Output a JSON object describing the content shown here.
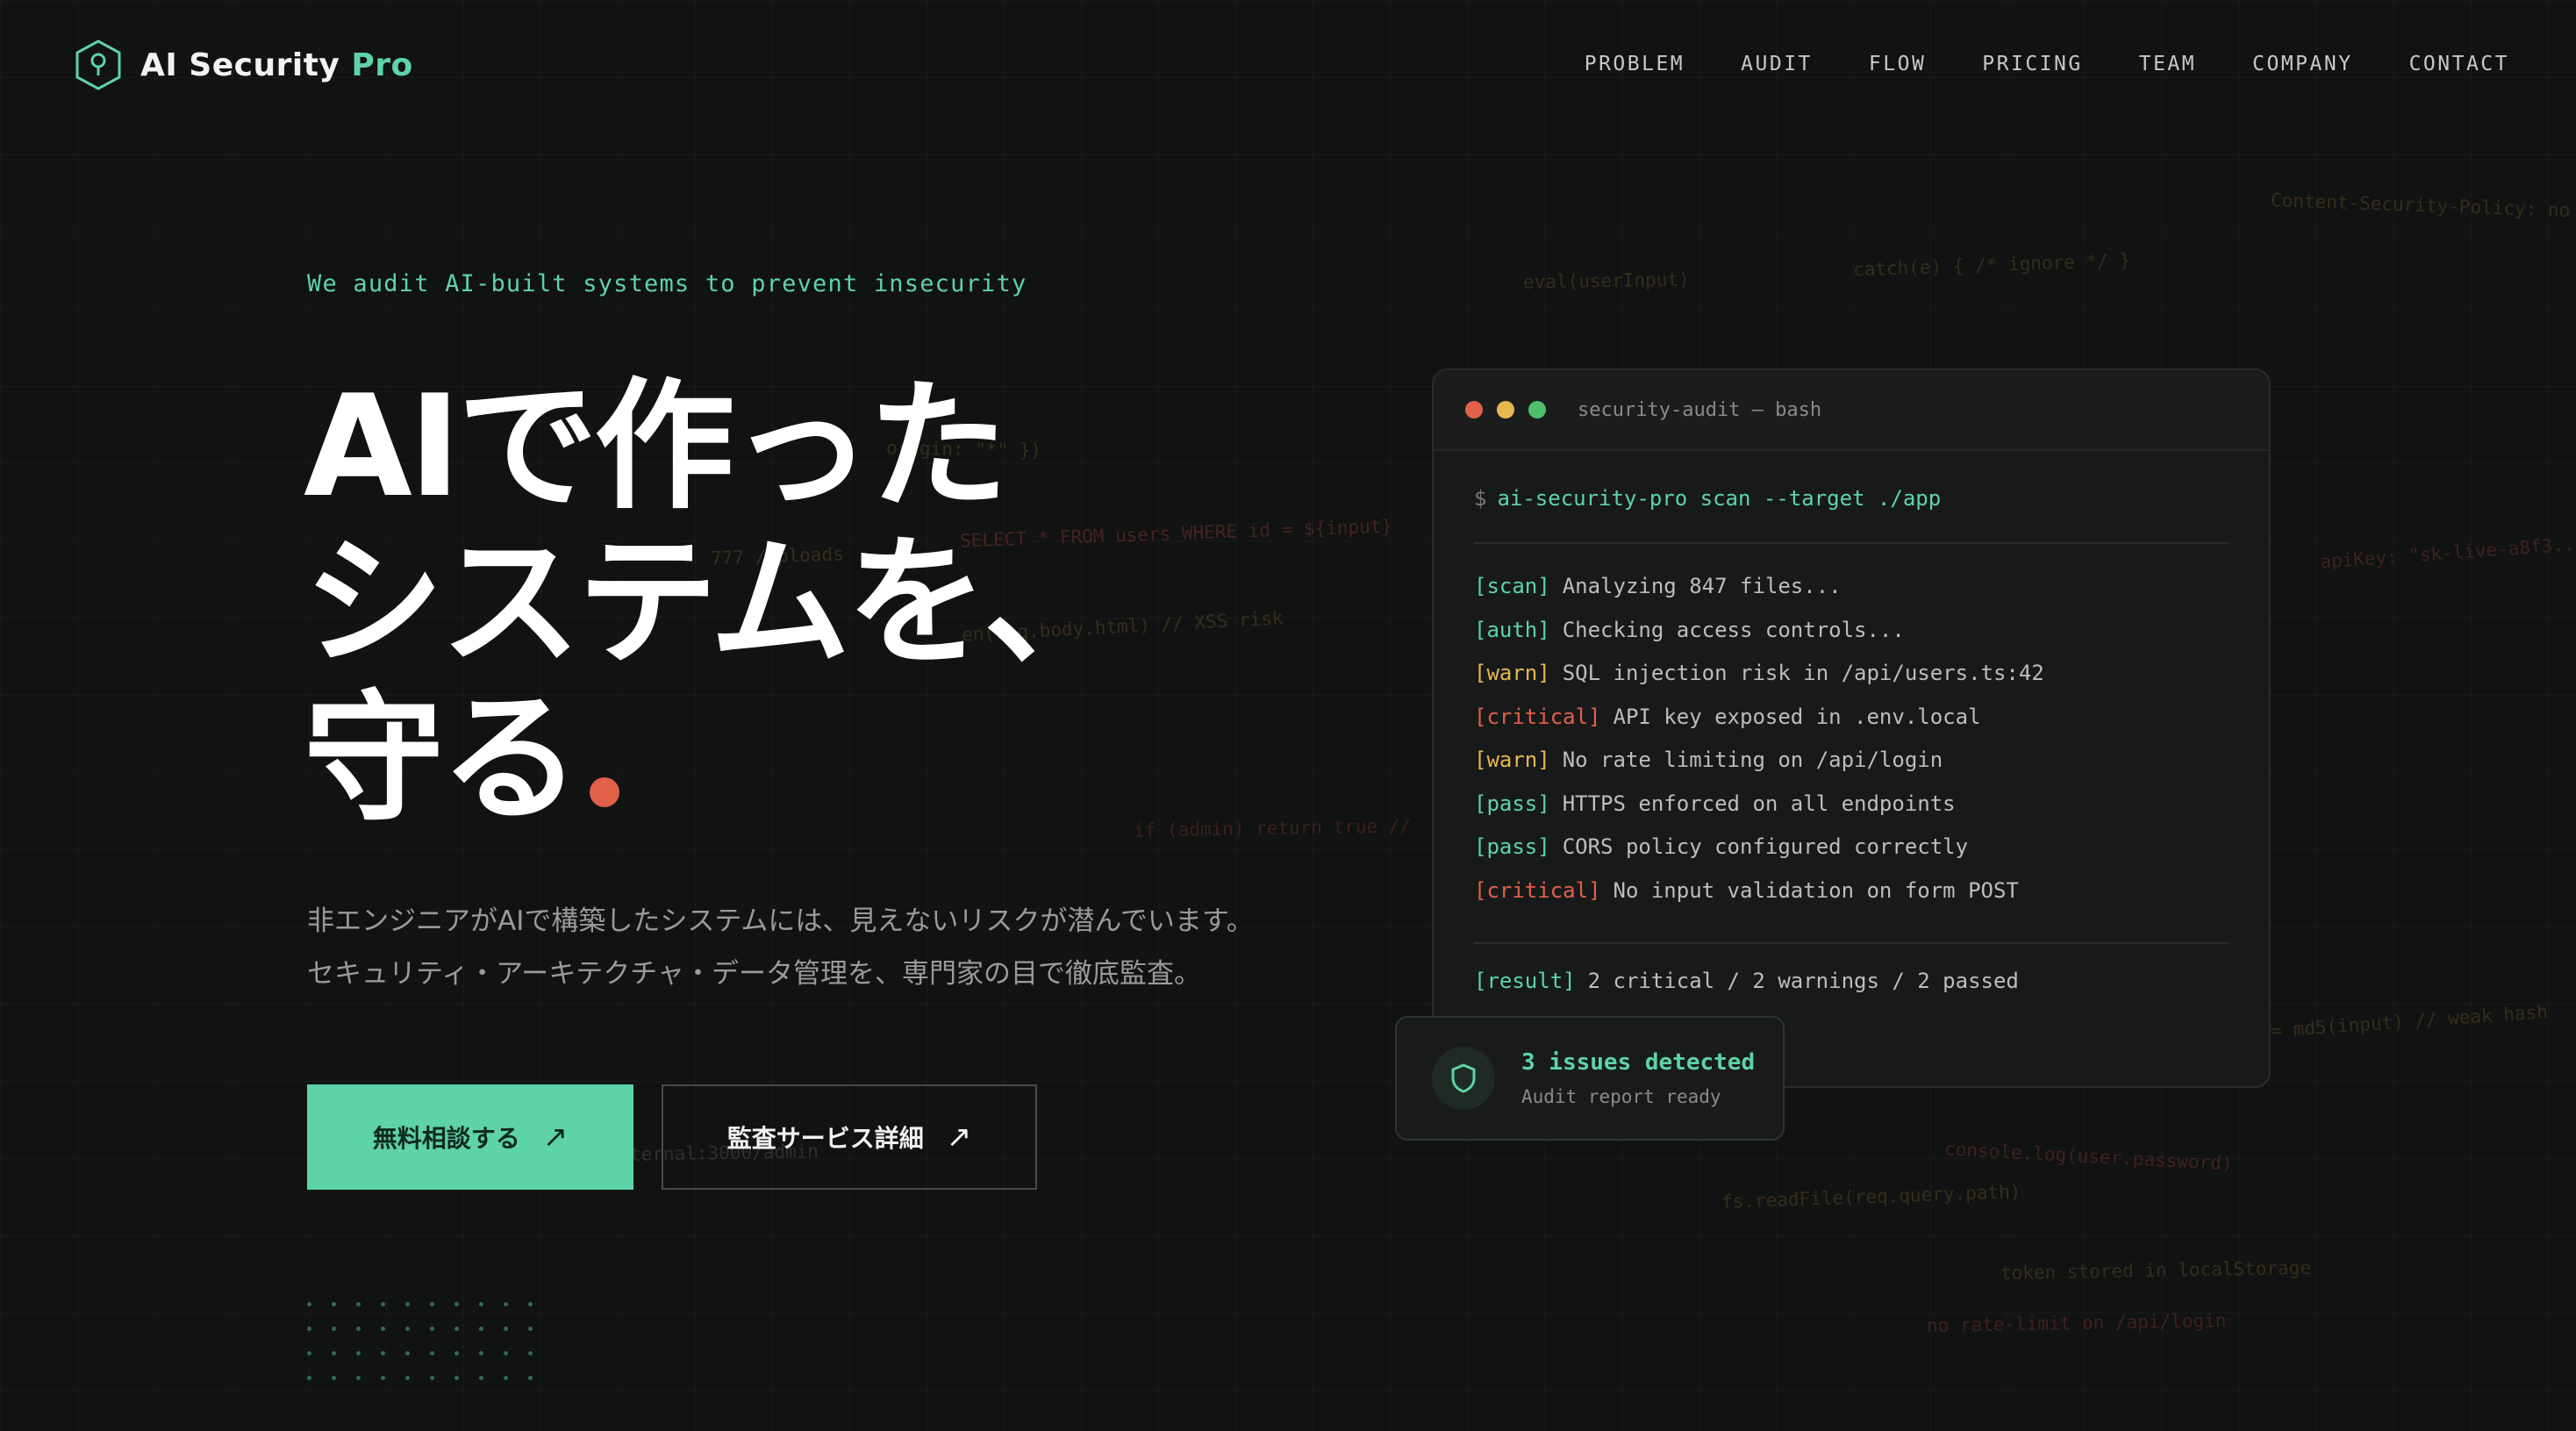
{
  "brand": {
    "name_main": "AI Security ",
    "name_accent": "Pro",
    "logo_icon": "hexagon-key-icon"
  },
  "nav": [
    "PROBLEM",
    "AUDIT",
    "FLOW",
    "PRICING",
    "TEAM",
    "COMPANY",
    "CONTACT"
  ],
  "hero": {
    "eyebrow": "We audit AI-built systems to prevent insecurity",
    "headline": [
      "AIで作った",
      "システムを、",
      "守る"
    ],
    "subtitle": [
      "非エンジニアがAIで構築したシステムには、見えないリスクが潜んでいます。",
      "セキュリティ・アーキテクチャ・データ管理を、専門家の目で徹底監査。"
    ],
    "cta_primary": "無料相談する",
    "cta_secondary": "監査サービス詳細",
    "arrow": "↗"
  },
  "snippets": [
    "eval(userInput)",
    "catch(e) { /* ignore */ }",
    "Content-Security-Policy: no",
    "origin: \"*\" })",
    "777 /uploads",
    "SELECT * FROM users WHERE id = ${input}",
    "apiKey: \"sk-live-a8f3...",
    "en(req.body.html) // XSS risk",
    "if (admin) return true //",
    "= md5(input) // weak hash",
    "console.log(user.password)",
    "fs.readFile(req.query.path)",
    "ternal:3000/admin",
    "token stored in localStorage",
    "no rate-limit on /api/login"
  ],
  "terminal": {
    "title": "security-audit — bash",
    "prompt": "$",
    "command": "ai-security-pro scan --target ./app",
    "lines": [
      {
        "tag": "[scan]",
        "kind": "scan",
        "text": "Analyzing 847 files..."
      },
      {
        "tag": "[auth]",
        "kind": "auth",
        "text": "Checking access controls..."
      },
      {
        "tag": "[warn]",
        "kind": "warn",
        "text": "SQL injection risk in /api/users.ts:42"
      },
      {
        "tag": "[critical]",
        "kind": "critical",
        "text": "API key exposed in .env.local"
      },
      {
        "tag": "[warn]",
        "kind": "warn",
        "text": "No rate limiting on /api/login"
      },
      {
        "tag": "[pass]",
        "kind": "pass",
        "text": "HTTPS enforced on all endpoints"
      },
      {
        "tag": "[pass]",
        "kind": "pass",
        "text": "CORS policy configured correctly"
      },
      {
        "tag": "[critical]",
        "kind": "critical",
        "text": "No input validation on form POST"
      }
    ],
    "result_tag": "[result]",
    "result_text": "2 critical / 2 warnings / 2 passed"
  },
  "badge": {
    "title": "3 issues detected",
    "subtitle": "Audit report ready",
    "icon": "shield-icon"
  },
  "colors": {
    "accent": "#5ed3a7",
    "warn": "#e6b84f",
    "critical": "#e0604a",
    "background": "#111212"
  }
}
